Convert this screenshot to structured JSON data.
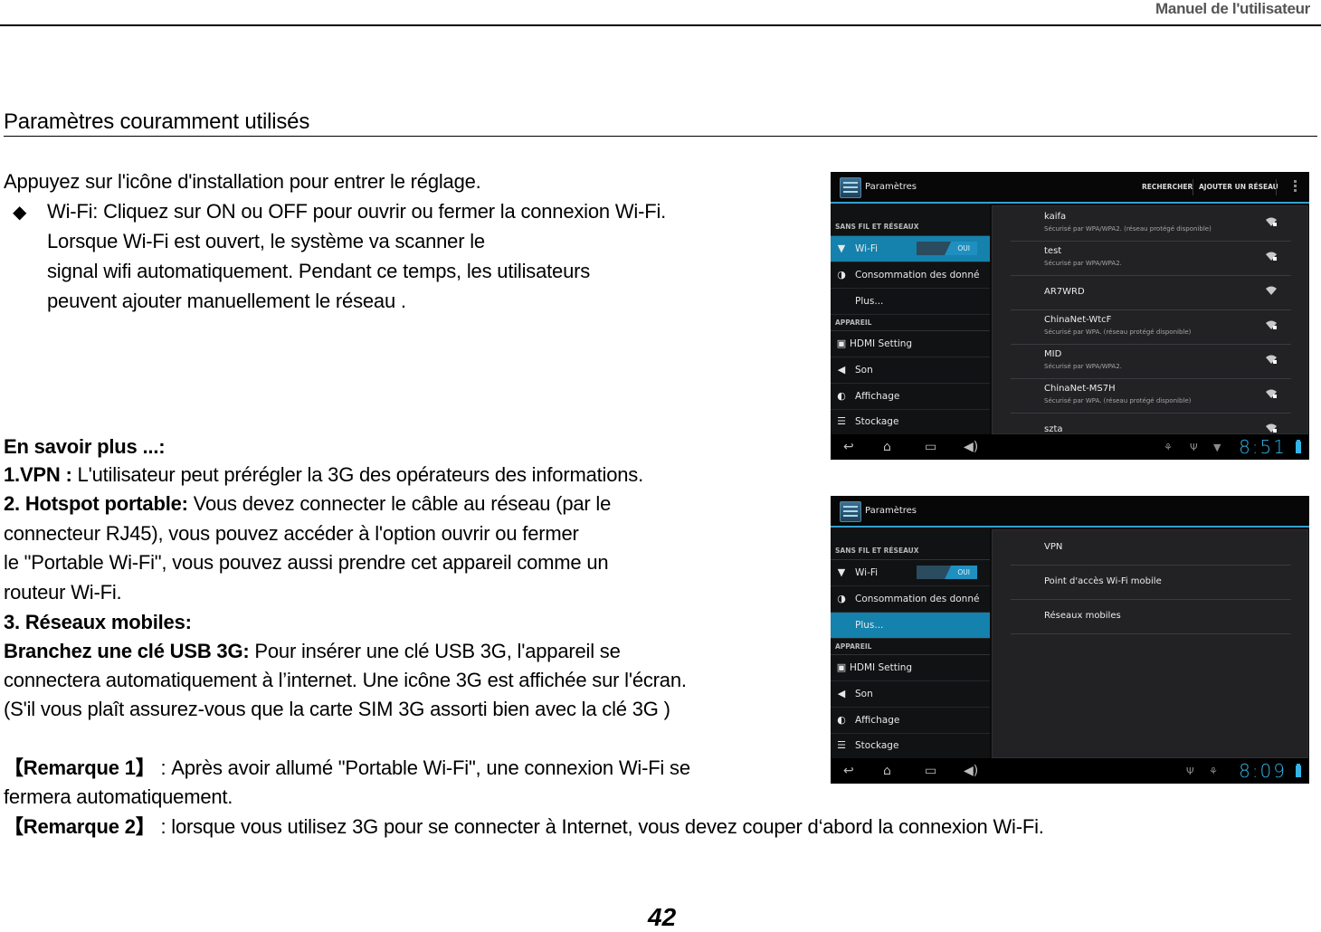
{
  "header": {
    "running_title": "Manuel de l'utilisateur",
    "section_title": "Paramètres couramment utilisés"
  },
  "intro": {
    "line1": "Appuyez sur l'icône d'installation pour entrer le réglage.",
    "bullet_icon": "diamond-bullet",
    "bullet_glyph": "◆",
    "wifi_lines": [
      "Wi-Fi: Cliquez sur ON ou OFF pour ouvrir ou fermer la connexion Wi-Fi.",
      "Lorsque Wi-Fi est ouvert, le système va scanner le",
      "signal wifi automatiquement. Pendant ce temps, les utilisateurs",
      "peuvent ajouter manuellement le réseau ."
    ]
  },
  "more": {
    "heading": "En savoir plus ...:",
    "vpn_label": "1.VPN :",
    "vpn_text": " L'utilisateur peut prérégler la 3G des opérateurs des informations.",
    "hotspot_label": "2. Hotspot portable:",
    "hotspot_text": " Vous devez connecter le câble au réseau (par le",
    "hotspot_lines": [
      "connecteur RJ45), vous pouvez accéder à l'option ouvrir ou fermer",
      "le \"Portable Wi-Fi\", vous pouvez aussi prendre cet appareil comme un",
      "routeur Wi-Fi."
    ],
    "mobile_heading": "3. Réseaux mobiles:",
    "usb_label": "Branchez une clé USB  3G:",
    "usb_text": " Pour insérer une clé USB 3G, l'appareil se",
    "usb_lines": [
      "connectera automatiquement à l’internet. Une icône 3G est affichée sur l'écran.",
      "(S'il vous plaît assurez-vous que la carte SIM 3G   assorti bien avec la clé 3G )"
    ]
  },
  "notes": {
    "note1_label": "【Remarque 1】",
    "note1_text": " : Après avoir allumé \"Portable Wi-Fi\", une connexion Wi-Fi se",
    "note1_cont": "fermera automatiquement.",
    "note2_label": "【Remarque 2】",
    "note2_text": " : lorsque vous utilisez 3G pour se connecter à Internet, vous devez couper d‘abord la connexion   Wi-Fi."
  },
  "page_number": "42",
  "screens": {
    "common": {
      "app_title": "Paramètres",
      "cat_wireless": "SANS FIL ET RÉSEAUX",
      "cat_device": "APPAREIL",
      "items": {
        "wifi": "Wi-Fi",
        "wifi_toggle": "OUI",
        "data_usage": "Consommation des donné",
        "more": "Plus...",
        "hdmi": "HDMI Setting",
        "sound": "Son",
        "display": "Affichage",
        "storage": "Stockage"
      },
      "accent_color": "#33b5e5",
      "selected_color": "#1581ad"
    },
    "wifi_screen": {
      "action_search": "RECHERCHER",
      "action_add": "AJOUTER UN RÉSEAU",
      "networks": [
        {
          "name": "kaifa",
          "status": "Sécurisé par WPA/WPA2. (réseau protégé disponible)",
          "secured": true
        },
        {
          "name": "test",
          "status": "Sécurisé par WPA/WPA2.",
          "secured": true
        },
        {
          "name": "AR7WRD",
          "status": "",
          "secured": false
        },
        {
          "name": "ChinaNet-WtcF",
          "status": "Sécurisé par WPA. (réseau protégé disponible)",
          "secured": true
        },
        {
          "name": "MID",
          "status": "Sécurisé par WPA/WPA2.",
          "secured": true
        },
        {
          "name": "ChinaNet-MS7H",
          "status": "Sécurisé par WPA. (réseau protégé disponible)",
          "secured": true
        },
        {
          "name": "szta",
          "status": "",
          "secured": true
        }
      ],
      "clock": "8:51"
    },
    "more_screen": {
      "options": [
        "VPN",
        "Point d'accès Wi-Fi mobile",
        "Réseaux mobiles"
      ],
      "clock": "8:09"
    }
  }
}
